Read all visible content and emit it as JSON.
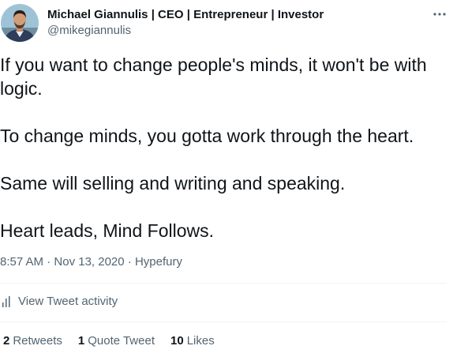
{
  "author": {
    "display_name": "Michael Giannulis | CEO | Entrepreneur | Investor",
    "handle": "@mikegiannulis",
    "avatar_icon": "profile-photo"
  },
  "more_icon": "more-horizontal-icon",
  "tweet": {
    "paragraphs": [
      "If you want to change people's minds, it won't be with logic.",
      "To change minds, you gotta work through the heart.",
      "Same will selling and writing and speaking.",
      "Heart leads, Mind Follows."
    ]
  },
  "meta": {
    "time": "8:57 AM",
    "date": "Nov 13, 2020",
    "source": "Hypefury",
    "separator": "·"
  },
  "activity": {
    "icon": "bar-chart-icon",
    "label": "View Tweet activity"
  },
  "stats": {
    "retweets_count": "2",
    "retweets_label": "Retweets",
    "quotes_count": "1",
    "quotes_label": "Quote Tweet",
    "likes_count": "10",
    "likes_label": "Likes"
  },
  "colors": {
    "text_primary": "#0f1419",
    "text_secondary": "#536471",
    "divider": "#eff3f4"
  }
}
